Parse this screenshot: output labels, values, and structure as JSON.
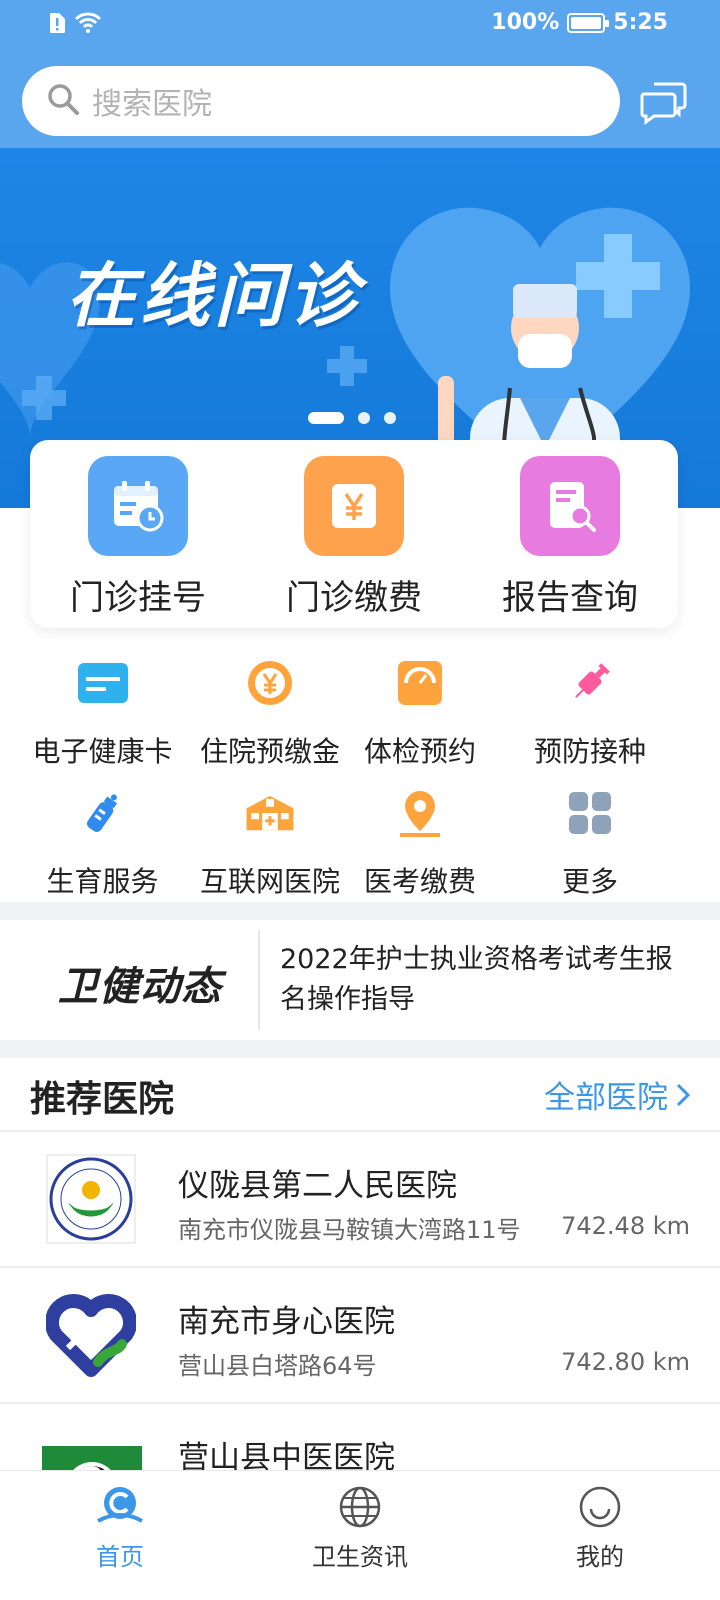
{
  "status_bar": {
    "battery": "100%",
    "time": "5:25"
  },
  "search": {
    "placeholder": "搜索医院"
  },
  "banner": {
    "title": "在线问诊",
    "slide_index": 1,
    "slide_count": 3
  },
  "main_services": [
    {
      "label": "门诊挂号",
      "icon": "calendar-clock-icon",
      "color": "#5aa8f5"
    },
    {
      "label": "门诊缴费",
      "icon": "yen-icon",
      "color": "#ffa24e"
    },
    {
      "label": "报告查询",
      "icon": "report-search-icon",
      "color": "#e87be0"
    }
  ],
  "services": [
    {
      "label": "电子健康卡",
      "icon": "health-card-icon",
      "color": "#2fb1ee"
    },
    {
      "label": "住院预缴金",
      "icon": "deposit-icon",
      "color": "#ffa43c"
    },
    {
      "label": "体检预约",
      "icon": "checkup-icon",
      "color": "#ffa43c"
    },
    {
      "label": "预防接种",
      "icon": "syringe-icon",
      "color": "#ff5a9c"
    },
    {
      "label": "生育服务",
      "icon": "baby-bottle-icon",
      "color": "#2f8bef"
    },
    {
      "label": "互联网医院",
      "icon": "hospital-building-icon",
      "color": "#ffa43c"
    },
    {
      "label": "医考缴费",
      "icon": "exam-pin-icon",
      "color": "#ffa43c"
    },
    {
      "label": "更多",
      "icon": "more-grid-icon",
      "color": "#8ea2ba"
    }
  ],
  "news": {
    "brand": "卫健动态",
    "headline": "2022年护士执业资格考试考生报名操作指导"
  },
  "recommend": {
    "title": "推荐医院",
    "all_label": "全部医院",
    "hospitals": [
      {
        "name": "仪陇县第二人民医院",
        "address": "南充市仪陇县马鞍镇大湾路11号",
        "distance": "742.48 km"
      },
      {
        "name": "南充市身心医院",
        "address": "营山县白塔路64号",
        "distance": "742.80 km"
      },
      {
        "name": "营山县中医医院",
        "address": "",
        "distance": ""
      }
    ]
  },
  "bottom_nav": [
    {
      "label": "首页",
      "active": true
    },
    {
      "label": "卫生资讯",
      "active": false
    },
    {
      "label": "我的",
      "active": false
    }
  ],
  "colors": {
    "header": "#5aa6ee",
    "banner": "#1f86e6",
    "accent": "#3b98e8"
  }
}
